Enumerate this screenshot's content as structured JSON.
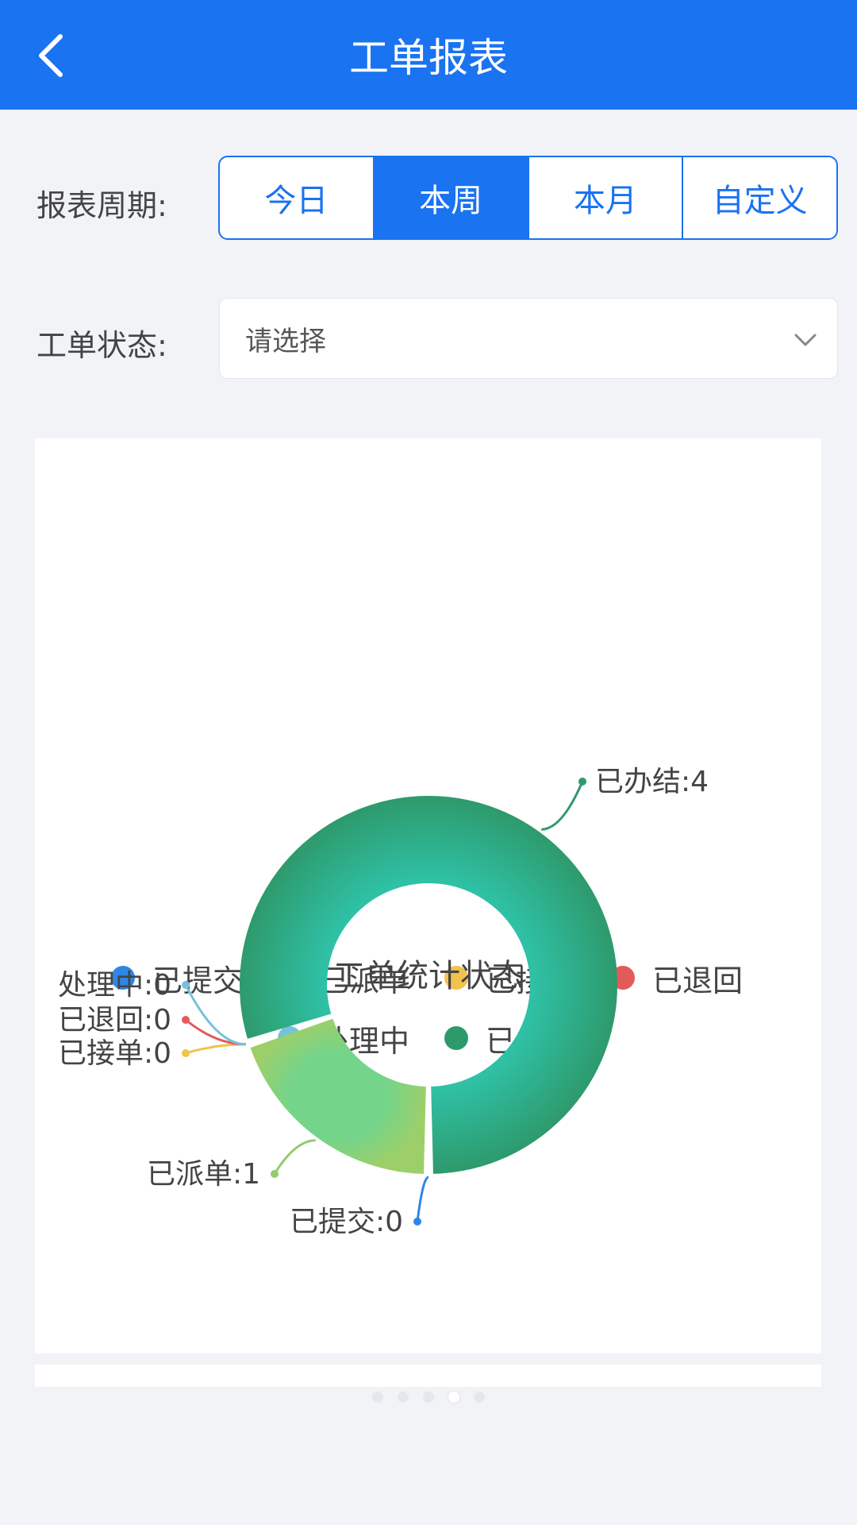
{
  "header": {
    "title": "工单报表"
  },
  "filters": {
    "period_label": "报表周期:",
    "period_options": [
      "今日",
      "本周",
      "本月",
      "自定义"
    ],
    "period_selected": "本周",
    "status_label": "工单状态:",
    "status_placeholder": "请选择"
  },
  "chart_data": {
    "type": "pie",
    "title": "工单统计状态",
    "categories": [
      "已提交",
      "已派单",
      "已接单",
      "已退回",
      "处理中",
      "已办结"
    ],
    "values": [
      0,
      1,
      0,
      0,
      0,
      4
    ],
    "colors": [
      "#2f86e6",
      "#92cc6e",
      "#f3c24c",
      "#e25a5a",
      "#77c1db",
      "#2e9a6c"
    ],
    "data_labels": [
      "已提交:0",
      "已派单:1",
      "已接单:0",
      "已退回:0",
      "处理中:0",
      "已办结:4"
    ],
    "legend_placement": "top"
  },
  "pager": {
    "pages": 5,
    "active": 4
  }
}
